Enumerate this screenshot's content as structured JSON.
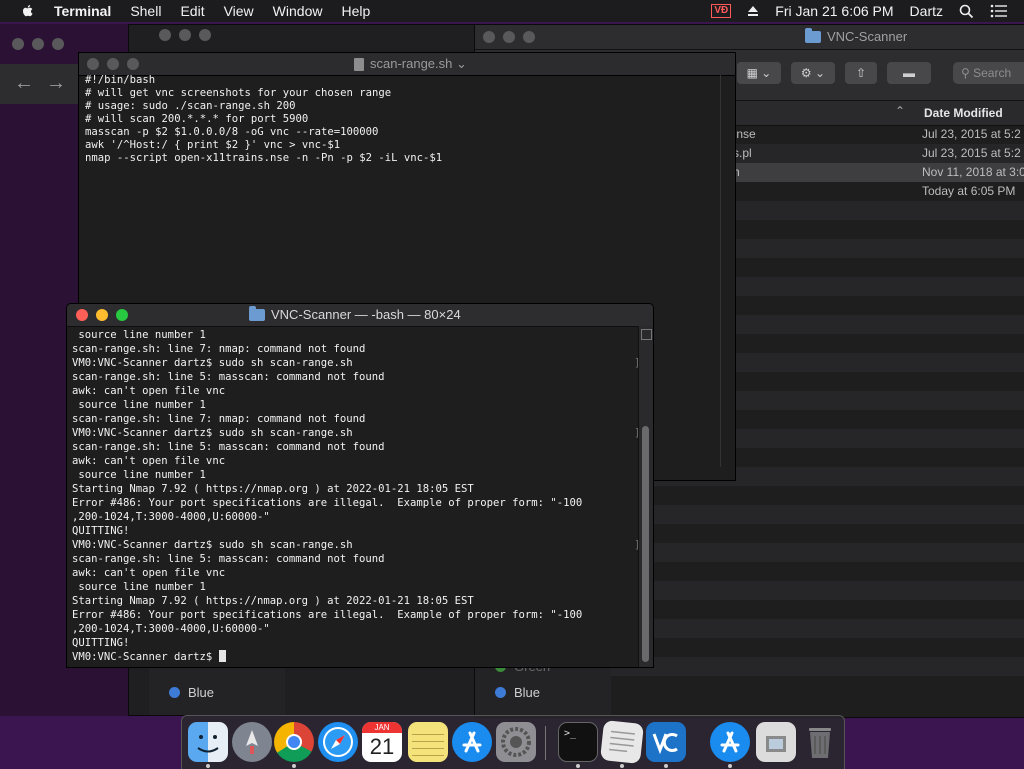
{
  "menubar": {
    "app_name": "Terminal",
    "items": [
      "Shell",
      "Edit",
      "View",
      "Window",
      "Help"
    ],
    "clock": "Fri Jan 21  6:06 PM",
    "user": "Dartz",
    "status_icons": [
      "vnc-icon",
      "eject-icon",
      "search-icon",
      "list-icon"
    ],
    "vnc_badge": "VƉ"
  },
  "finder": {
    "title": "VNC-Scanner",
    "search_placeholder": "Search",
    "column_header": "Date Modified",
    "rows": [
      {
        "name": ".nse",
        "date": "Jul 23, 2015 at 5:2"
      },
      {
        "name": "s.pl",
        "date": "Jul 23, 2015 at 5:2"
      },
      {
        "name": "h",
        "date": "Nov 11, 2018 at 3:0"
      },
      {
        "name": "",
        "date": "Today at 6:05 PM"
      }
    ]
  },
  "back_windows": {
    "tag_green": "Green",
    "tag_blue": "Blue"
  },
  "editor": {
    "title": "scan-range.sh ⌄",
    "code_lines": [
      "#!/bin/bash",
      "# will get vnc screenshots for your chosen range",
      "# usage: sudo ./scan-range.sh 200",
      "# will scan 200.*.*.* for port 5900",
      "masscan -p $2 $1.0.0.0/8 -oG vnc --rate=100000",
      "awk '/^Host:/ { print $2 }' vnc > vnc-$1",
      "nmap --script open-x11trains.nse -n -Pn -p $2 -iL vnc-$1"
    ]
  },
  "terminal": {
    "title": "VNC-Scanner — -bash — 80×24",
    "lines": [
      " source line number 1",
      "scan-range.sh: line 7: nmap: command not found",
      "VM0:VNC-Scanner dartz$ sudo sh scan-range.sh",
      "scan-range.sh: line 5: masscan: command not found",
      "awk: can't open file vnc",
      " source line number 1",
      "scan-range.sh: line 7: nmap: command not found",
      "VM0:VNC-Scanner dartz$ sudo sh scan-range.sh",
      "scan-range.sh: line 5: masscan: command not found",
      "awk: can't open file vnc",
      " source line number 1",
      "Starting Nmap 7.92 ( https://nmap.org ) at 2022-01-21 18:05 EST",
      "Error #486: Your port specifications are illegal.  Example of proper form: \"-100",
      ",200-1024,T:3000-4000,U:60000-\"",
      "QUITTING!",
      "VM0:VNC-Scanner dartz$ sudo sh scan-range.sh",
      "scan-range.sh: line 5: masscan: command not found",
      "awk: can't open file vnc",
      " source line number 1",
      "Starting Nmap 7.92 ( https://nmap.org ) at 2022-01-21 18:05 EST",
      "Error #486: Your port specifications are illegal.  Example of proper form: \"-100",
      ",200-1024,T:3000-4000,U:60000-\"",
      "QUITTING!",
      "VM0:VNC-Scanner dartz$ "
    ]
  },
  "dock": {
    "items": [
      "finder-icon",
      "launchpad-icon",
      "chrome-icon",
      "safari-icon",
      "calendar-icon",
      "notes-icon",
      "app-store-icon",
      "system-preferences-icon",
      "terminal-icon",
      "textedit-icon",
      "vnc-viewer-icon",
      "app-store-2-icon",
      "preview-icon",
      "trash-icon"
    ],
    "calendar_month": "JAN",
    "calendar_day": "21",
    "terminal_glyph": ">_"
  }
}
